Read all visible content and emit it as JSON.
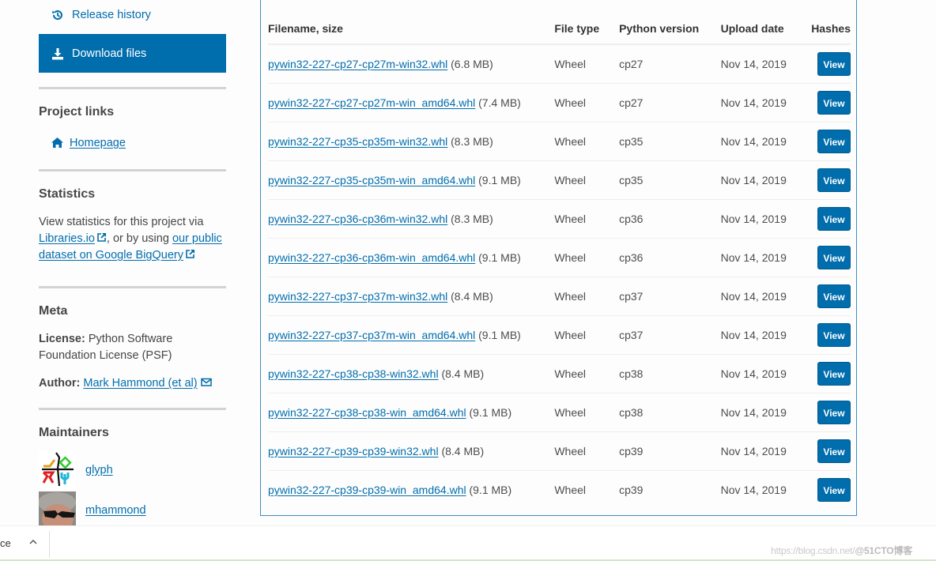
{
  "sidebar": {
    "release_history": "Release history",
    "download_files": "Download files",
    "project_links": {
      "heading": "Project links",
      "homepage": "Homepage"
    },
    "statistics": {
      "heading": "Statistics",
      "text_before": "View statistics for this project via ",
      "libraries_link": "Libraries.io",
      "text_middle": ", or by using ",
      "bigquery_link": "our public dataset on Google BigQuery"
    },
    "meta": {
      "heading": "Meta",
      "license_label": "License:",
      "license_value": " Python Software Foundation License (PSF)",
      "author_label": "Author:",
      "author_value": "Mark Hammond (et al)"
    },
    "maintainers": {
      "heading": "Maintainers",
      "items": [
        {
          "name": "glyph"
        },
        {
          "name": "mhammond"
        }
      ]
    }
  },
  "table": {
    "headers": [
      "Filename, size",
      "File type",
      "Python version",
      "Upload date",
      "Hashes"
    ],
    "rows": [
      {
        "filename": "pywin32-227-cp27-cp27m-win32.whl",
        "size": "(6.8 MB)",
        "type": "Wheel",
        "python": "cp27",
        "date": "Nov 14, 2019",
        "hash_btn": "View"
      },
      {
        "filename": "pywin32-227-cp27-cp27m-win_amd64.whl",
        "size": "(7.4 MB)",
        "type": "Wheel",
        "python": "cp27",
        "date": "Nov 14, 2019",
        "hash_btn": "View"
      },
      {
        "filename": "pywin32-227-cp35-cp35m-win32.whl",
        "size": "(8.3 MB)",
        "type": "Wheel",
        "python": "cp35",
        "date": "Nov 14, 2019",
        "hash_btn": "View"
      },
      {
        "filename": "pywin32-227-cp35-cp35m-win_amd64.whl",
        "size": "(9.1 MB)",
        "type": "Wheel",
        "python": "cp35",
        "date": "Nov 14, 2019",
        "hash_btn": "View"
      },
      {
        "filename": "pywin32-227-cp36-cp36m-win32.whl",
        "size": "(8.3 MB)",
        "type": "Wheel",
        "python": "cp36",
        "date": "Nov 14, 2019",
        "hash_btn": "View"
      },
      {
        "filename": "pywin32-227-cp36-cp36m-win_amd64.whl",
        "size": "(9.1 MB)",
        "type": "Wheel",
        "python": "cp36",
        "date": "Nov 14, 2019",
        "hash_btn": "View"
      },
      {
        "filename": "pywin32-227-cp37-cp37m-win32.whl",
        "size": "(8.4 MB)",
        "type": "Wheel",
        "python": "cp37",
        "date": "Nov 14, 2019",
        "hash_btn": "View"
      },
      {
        "filename": "pywin32-227-cp37-cp37m-win_amd64.whl",
        "size": "(9.1 MB)",
        "type": "Wheel",
        "python": "cp37",
        "date": "Nov 14, 2019",
        "hash_btn": "View"
      },
      {
        "filename": "pywin32-227-cp38-cp38-win32.whl",
        "size": "(8.4 MB)",
        "type": "Wheel",
        "python": "cp38",
        "date": "Nov 14, 2019",
        "hash_btn": "View"
      },
      {
        "filename": "pywin32-227-cp38-cp38-win_amd64.whl",
        "size": "(9.1 MB)",
        "type": "Wheel",
        "python": "cp38",
        "date": "Nov 14, 2019",
        "hash_btn": "View"
      },
      {
        "filename": "pywin32-227-cp39-cp39-win32.whl",
        "size": "(8.4 MB)",
        "type": "Wheel",
        "python": "cp39",
        "date": "Nov 14, 2019",
        "hash_btn": "View"
      },
      {
        "filename": "pywin32-227-cp39-cp39-win_amd64.whl",
        "size": "(9.1 MB)",
        "type": "Wheel",
        "python": "cp39",
        "date": "Nov 14, 2019",
        "hash_btn": "View"
      }
    ]
  },
  "download_bar": {
    "fragment": "ce"
  },
  "watermark": {
    "url": "https://blog.csdn.net/",
    "brand": "@51CTO博客"
  },
  "colors": {
    "accent": "#006dad",
    "panel_border": "#3f8fc1",
    "text": "#464646"
  }
}
